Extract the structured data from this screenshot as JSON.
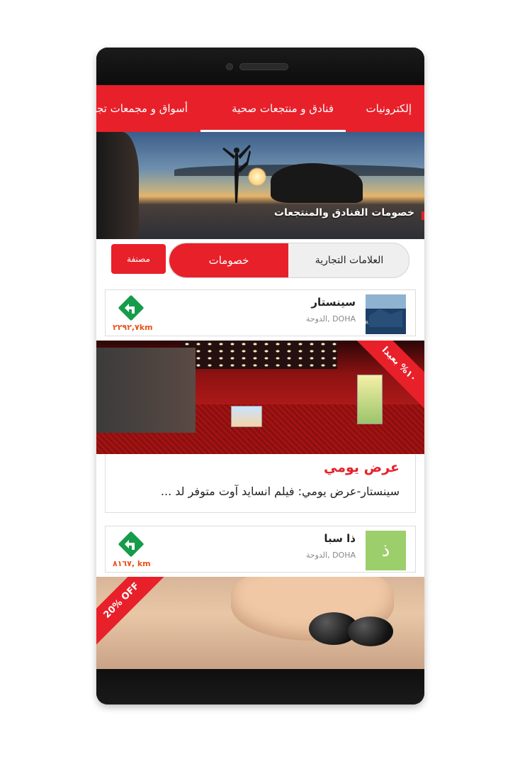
{
  "tabs": {
    "items": [
      {
        "label": "إلكترونيات"
      },
      {
        "label": "فنادق و منتجعات صحية"
      },
      {
        "label": "أسواق و مجمعات تجارية"
      }
    ],
    "active_index": 1
  },
  "banner": {
    "title": "خصومات الفنادق والمنتجعات"
  },
  "segmented": {
    "brands_label": "العلامات التجارية",
    "deals_label": "خصومات",
    "active": "deals"
  },
  "category_button": "مصنفة",
  "cards": [
    {
      "name": "سينستار",
      "city": "DOHA ,الدوحة",
      "distance": "٢٢٩٢,٧km",
      "ribbon": "١٠%\nبعيدا",
      "offer_title": "عرض يومي",
      "offer_desc": "سينستار-عرض يومي: فيلم انساید آوت متوفر لد ..."
    },
    {
      "name": "ذا سبا",
      "city": "DOHA ,الدوحة",
      "distance": "٨١٦٧, km",
      "logo_letter": "ذ",
      "ribbon": "20% OFF"
    }
  ],
  "colors": {
    "brand_red": "#e8202a",
    "distance_orange": "#e8531d",
    "nav_green": "#169c4a",
    "spa_logo_green": "#9ccf6b"
  },
  "icons": {
    "navigate": "turn-left-diamond-icon"
  }
}
